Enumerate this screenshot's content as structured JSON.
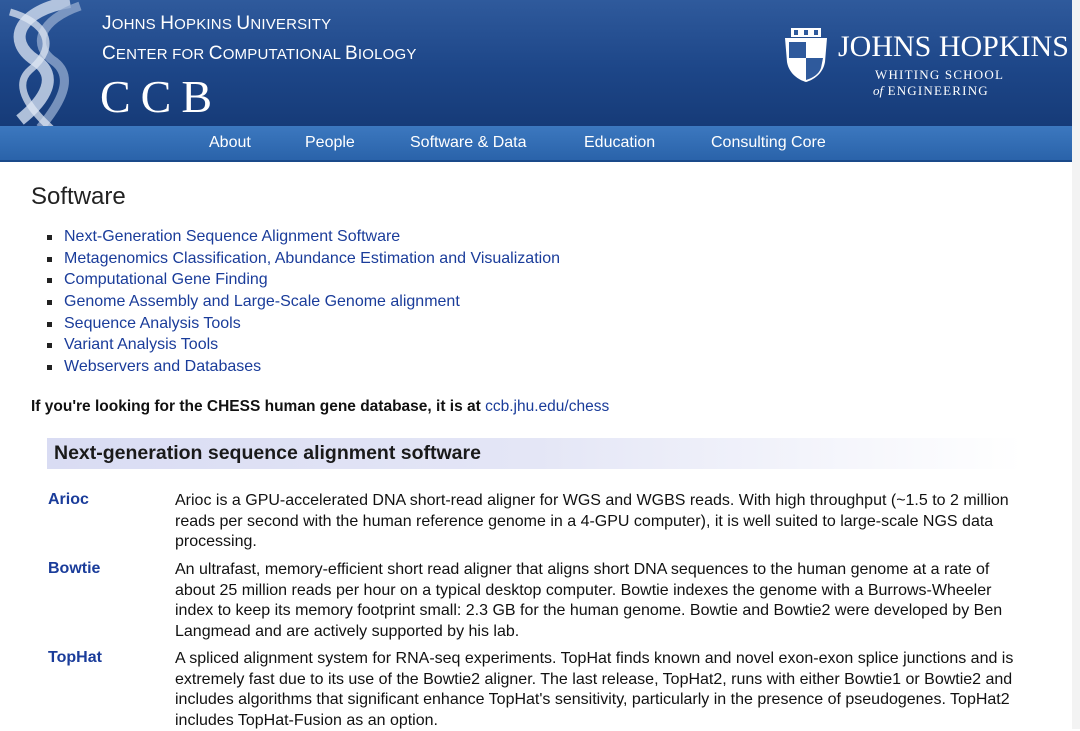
{
  "header": {
    "org_line1_parts": [
      {
        "text": "J",
        "big": true
      },
      {
        "text": "OHNS ",
        "big": false
      },
      {
        "text": "H",
        "big": true
      },
      {
        "text": "OPKINS ",
        "big": false
      },
      {
        "text": "U",
        "big": true
      },
      {
        "text": "NIVERSITY",
        "big": false
      }
    ],
    "org_line2_parts": [
      {
        "text": "C",
        "big": true
      },
      {
        "text": "ENTER FOR ",
        "big": false
      },
      {
        "text": "C",
        "big": true
      },
      {
        "text": "OMPUTATIONAL ",
        "big": false
      },
      {
        "text": "B",
        "big": true
      },
      {
        "text": "IOLOGY",
        "big": false
      }
    ],
    "ccb_logo": "CCB",
    "jhu_name": "JOHNS HOPKINS",
    "jhu_sub1": "WHITING SCHOOL",
    "jhu_sub2_of": "of",
    "jhu_sub2_rest": " ENGINEERING",
    "colors": {
      "header_bg": "#1d4688",
      "nav_bg": "#2f6bb3"
    }
  },
  "nav": {
    "items": [
      "About",
      "People",
      "Software & Data",
      "Education",
      "Consulting Core"
    ]
  },
  "page": {
    "title": "Software",
    "toc": [
      "Next-Generation Sequence Alignment Software",
      "Metagenomics Classification, Abundance Estimation and Visualization",
      "Computational Gene Finding",
      "Genome Assembly and Large-Scale Genome alignment",
      "Sequence Analysis Tools",
      "Variant Analysis Tools",
      "Webservers and Databases"
    ],
    "chess_note": "If you're looking for the CHESS human gene database, it is at ",
    "chess_link": "ccb.jhu.edu/chess",
    "section_title": "Next-generation sequence alignment software",
    "software": [
      {
        "name": "Arioc",
        "desc": "Arioc is a GPU-accelerated DNA short-read aligner for WGS and WGBS reads. With high throughput (~1.5 to 2 million reads per second with the human reference genome in a 4-GPU computer), it is well suited to large-scale NGS data processing."
      },
      {
        "name": "Bowtie",
        "desc": "An ultrafast, memory-efficient short read aligner that aligns short DNA sequences to the human genome at a rate of about 25 million reads per hour on a typical desktop computer. Bowtie indexes the genome with a Burrows-Wheeler index to keep its memory footprint small: 2.3 GB for the human genome. Bowtie and Bowtie2 were developed by Ben Langmead and are actively supported by his lab."
      },
      {
        "name": "TopHat",
        "desc": "A spliced alignment system for RNA-seq experiments. TopHat finds known and novel exon-exon splice junctions and is extremely fast due to its use of the Bowtie2 aligner. The last release, TopHat2, runs with either Bowtie1 or Bowtie2 and includes algorithms that significant enhance TopHat's sensitivity, particularly in the presence of pseudogenes. TopHat2 includes TopHat-Fusion as an option."
      }
    ]
  }
}
